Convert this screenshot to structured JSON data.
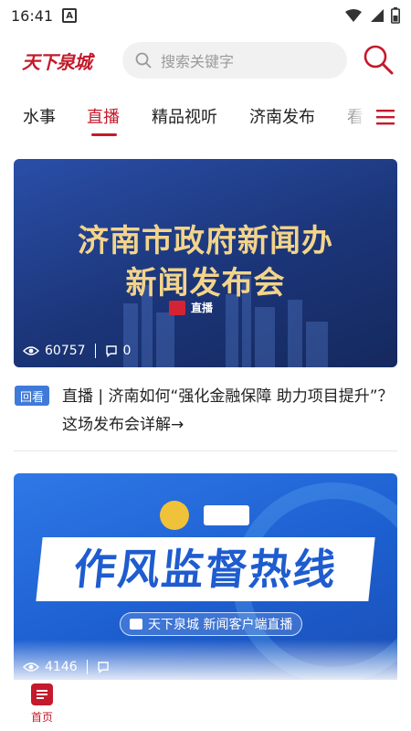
{
  "status_bar": {
    "time": "16:41",
    "notification_letter": "A"
  },
  "header": {
    "logo_text": "天下泉城",
    "search_placeholder": "搜索关键字"
  },
  "tabs": [
    {
      "label": "水事",
      "active": false
    },
    {
      "label": "直播",
      "active": true
    },
    {
      "label": "精品视听",
      "active": false
    },
    {
      "label": "济南发布",
      "active": false
    },
    {
      "label": "看",
      "active": false
    }
  ],
  "cards": [
    {
      "image_title_line1": "济南市政府新闻办",
      "image_title_line2": "新闻发布会",
      "image_badge": "直播",
      "views": "60757",
      "comments": "0",
      "tag": "回看",
      "caption": "直播 | 济南如何“强化金融保障 助力项目提升”？ 这场发布会详解→"
    },
    {
      "image_title": "作风监督热线",
      "image_subtitle": "天下泉城 新闻客户端直播",
      "views": "4146"
    }
  ],
  "bottom_nav": {
    "home_label": "首页"
  },
  "colors": {
    "accent": "#c41a2b",
    "replay_badge": "#3f7ad9"
  }
}
